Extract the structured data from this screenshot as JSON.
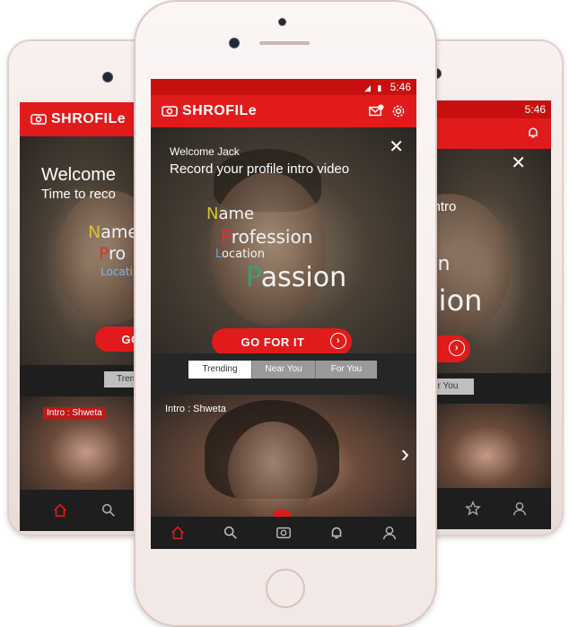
{
  "status": {
    "time": "5:46"
  },
  "brand": {
    "name": "SHROFILe",
    "color": "#e11b1b"
  },
  "center": {
    "welcome_line1": "Welcome Jack",
    "welcome_line2": "Record your profile intro video",
    "words": {
      "name_first": "N",
      "name_rest": "ame",
      "profession_first": "P",
      "profession_rest": "rofession",
      "location_first": "L",
      "location_rest": "ocation",
      "passion_first": "P",
      "passion_rest": "assion"
    },
    "go_button": "GO FOR IT",
    "tabs": [
      "Trending",
      "Near You",
      "For You"
    ],
    "intro": "Intro : Shweta"
  },
  "left": {
    "welcome_line1": "Welcome",
    "welcome_line2": "Time to reco",
    "name_first": "N",
    "name_rest": "ame",
    "profession_first": "P",
    "profession_rest": "ro",
    "location_text": "Locati",
    "go_button": "GO",
    "tab": "Trend",
    "intro": "Intro : Shweta"
  },
  "right": {
    "time": "5:46",
    "word1": "n",
    "word2": "r intro",
    "word3": "on",
    "word4": "sion",
    "tab": "r You"
  },
  "nav_icons": [
    "home-icon",
    "search-icon",
    "camera-icon",
    "bell-icon",
    "user-icon"
  ]
}
